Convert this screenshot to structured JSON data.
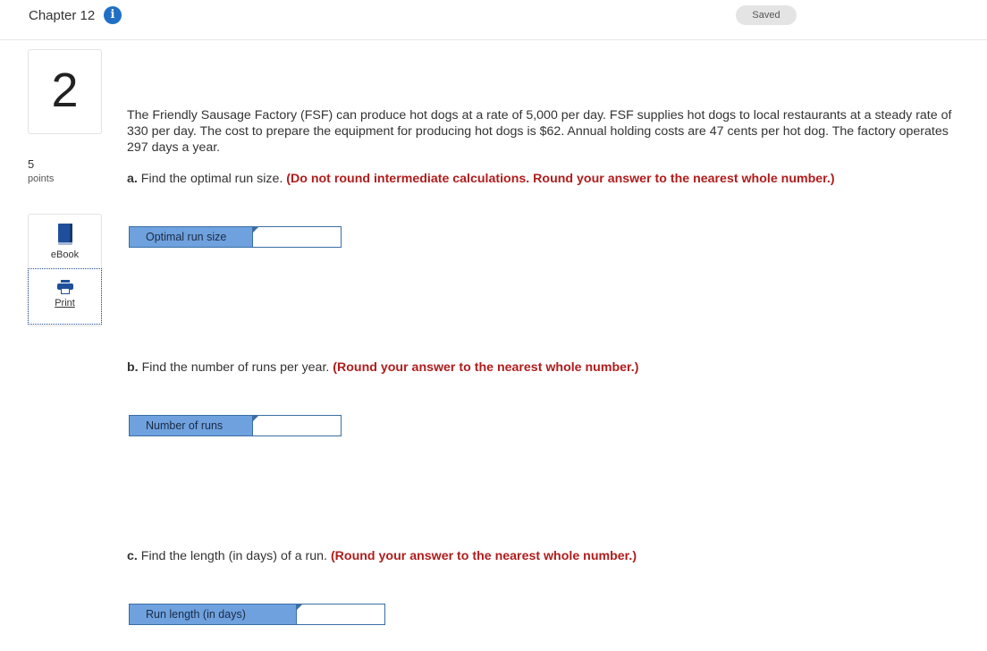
{
  "header": {
    "chapter_title": "Chapter 12",
    "info_icon": "info-icon",
    "saved_label": "Saved"
  },
  "question": {
    "number": "2",
    "points_value": "5",
    "points_label": "points",
    "text": "The Friendly Sausage Factory (FSF) can produce hot dogs at a rate of 5,000 per day. FSF supplies hot dogs to local restaurants at a steady rate of 330 per day. The cost to prepare the equipment for producing hot dogs is $62. Annual holding costs are 47 cents per hot dog. The factory operates 297 days a year."
  },
  "tools": {
    "ebook_label": "eBook",
    "ebook_icon": "book-icon",
    "print_label": "Print",
    "print_icon": "printer-icon"
  },
  "parts": [
    {
      "letter": "a.",
      "prompt": "Find the optimal run size.",
      "instruction": "(Do not round intermediate calculations. Round your answer to the nearest whole number.)",
      "field_label": "Optimal run size",
      "field_value": ""
    },
    {
      "letter": "b.",
      "prompt": "Find the number of runs per year.",
      "instruction": "(Round your answer to the nearest whole number.)",
      "field_label": "Number of runs",
      "field_value": ""
    },
    {
      "letter": "c.",
      "prompt": "Find the length (in days) of a run.",
      "instruction": "(Round your answer to the nearest whole number.)",
      "field_label": "Run length (in days)",
      "field_value": ""
    }
  ],
  "colors": {
    "accent_blue": "#1f6fc5",
    "instruction_red": "#b11c1c",
    "answer_label_bg": "#6fa1de"
  }
}
